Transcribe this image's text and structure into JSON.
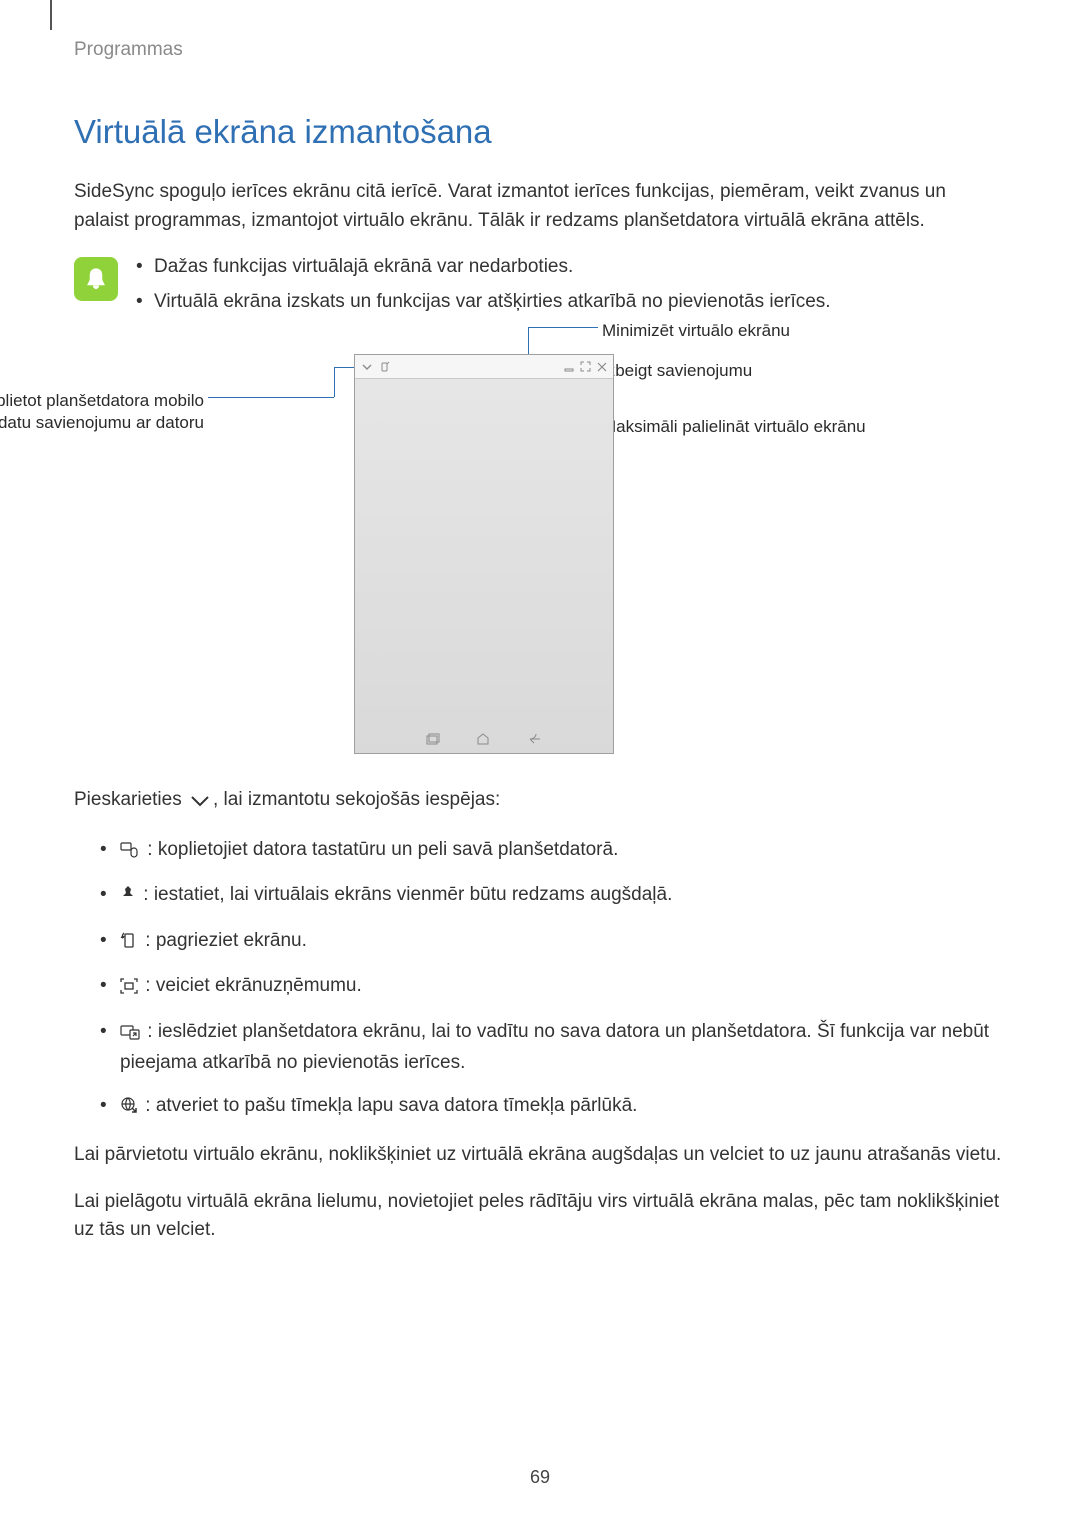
{
  "header": {
    "section": "Programmas"
  },
  "title": "Virtuālā ekrāna izmantošana",
  "intro": "SideSync spoguļo ierīces ekrānu citā ierīcē. Varat izmantot ierīces funkcijas, piemēram, veikt zvanus un palaist programmas, izmantojot virtuālo ekrānu. Tālāk ir redzams planšetdatora virtuālā ekrāna attēls.",
  "notes": {
    "items": [
      "Dažas funkcijas virtuālajā ekrānā var nedarboties.",
      "Virtuālā ekrāna izskats un funkcijas var atšķirties atkarībā no pievienotās ierīces."
    ]
  },
  "callouts": {
    "share": "Koplietot planšetdatora mobilo datu savienojumu ar datoru",
    "minimize": "Minimizēt virtuālo ekrānu",
    "close": "Izbeigt savienojumu",
    "maximize": "Maksimāli palielināt virtuālo ekrānu"
  },
  "touch": {
    "before": "Pieskarieties ",
    "after": ", lai izmantotu sekojošās iespējas:"
  },
  "options": [
    ": koplietojiet datora tastatūru un peli savā planšetdatorā.",
    ": iestatiet, lai virtuālais ekrāns vienmēr būtu redzams augšdaļā.",
    ": pagrieziet ekrānu.",
    ": veiciet ekrānuzņēmumu.",
    ": ieslēdziet planšetdatora ekrānu, lai to vadītu no sava datora un planšetdatora. Šī funkcija var nebūt pieejama atkarībā no pievienotās ierīces.",
    ": atveriet to pašu tīmekļa lapu sava datora tīmekļa pārlūkā."
  ],
  "para_move": "Lai pārvietotu virtuālo ekrānu, noklikšķiniet uz virtuālā ekrāna augšdaļas un velciet to uz jaunu atrašanās vietu.",
  "para_resize": "Lai pielāgotu virtuālā ekrāna lielumu, novietojiet peles rādītāju virs virtuālā ekrāna malas, pēc tam noklikšķiniet uz tās un velciet.",
  "page_number": "69"
}
